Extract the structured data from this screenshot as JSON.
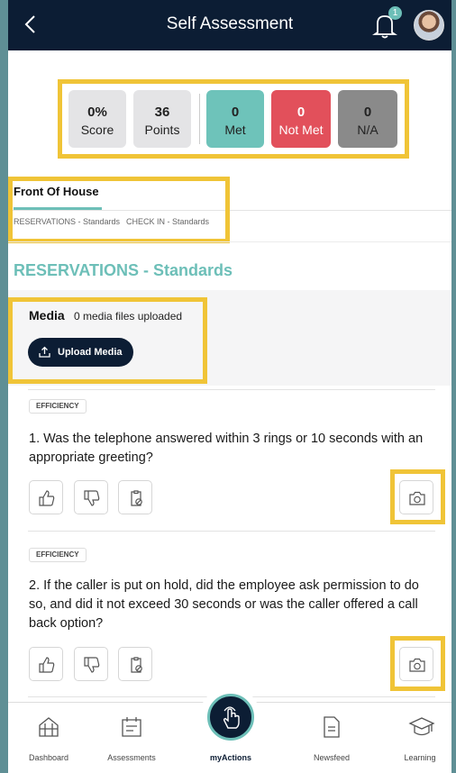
{
  "header": {
    "title": "Self Assessment",
    "notification_count": "1"
  },
  "stats": [
    {
      "value": "0%",
      "label": "Score"
    },
    {
      "value": "36",
      "label": "Points"
    },
    {
      "value": "0",
      "label": "Met"
    },
    {
      "value": "0",
      "label": "Not Met"
    },
    {
      "value": "0",
      "label": "N/A"
    }
  ],
  "tabs": {
    "active": "Front Of House",
    "subtabs": [
      "RESERVATIONS - Standards",
      "CHECK IN - Standards"
    ]
  },
  "section": {
    "title": "RESERVATIONS - Standards"
  },
  "media": {
    "label": "Media",
    "count_text": "0 media files uploaded",
    "button_label": "Upload Media"
  },
  "questions": [
    {
      "tag": "EFFICIENCY",
      "text": "1. Was the telephone answered within 3 rings or 10 seconds with an appropriate greeting?"
    },
    {
      "tag": "EFFICIENCY",
      "text": "2. If the caller is put on hold, did the employee ask permission to do so, and did it not exceed 30 seconds or was the caller offered a call back option?"
    }
  ],
  "tabbar": {
    "items": [
      "Dashboard",
      "Assessments",
      "myActions",
      "Newsfeed",
      "Learning"
    ]
  },
  "colors": {
    "navy": "#0c1d34",
    "teal": "#6dbfb8",
    "met": "#6ec3ba",
    "not_met": "#e2505b",
    "na": "#8a8a8a",
    "highlight": "#f0c437"
  }
}
